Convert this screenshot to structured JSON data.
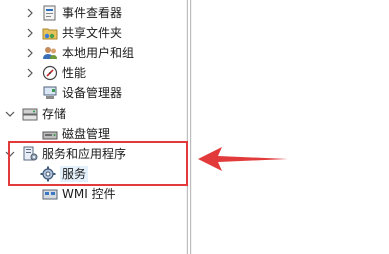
{
  "tree": {
    "items": [
      {
        "label": "事件查看器",
        "expand": "collapsed",
        "icon": "event-viewer-icon"
      },
      {
        "label": "共享文件夹",
        "expand": "collapsed",
        "icon": "shared-folders-icon"
      },
      {
        "label": "本地用户和组",
        "expand": "collapsed",
        "icon": "local-users-icon"
      },
      {
        "label": "性能",
        "expand": "collapsed",
        "icon": "performance-icon"
      },
      {
        "label": "设备管理器",
        "expand": "none",
        "icon": "device-manager-icon"
      },
      {
        "label": "存储",
        "expand": "expanded",
        "icon": "storage-icon"
      },
      {
        "label": "磁盘管理",
        "expand": "none",
        "icon": "disk-management-icon"
      },
      {
        "label": "服务和应用程序",
        "expand": "expanded",
        "icon": "services-apps-icon"
      },
      {
        "label": "服务",
        "expand": "none",
        "icon": "services-gear-icon",
        "selected": true
      },
      {
        "label": "WMI 控件",
        "expand": "none",
        "icon": "wmi-control-icon"
      }
    ]
  },
  "annotation": {
    "color": "#e23a3a"
  }
}
